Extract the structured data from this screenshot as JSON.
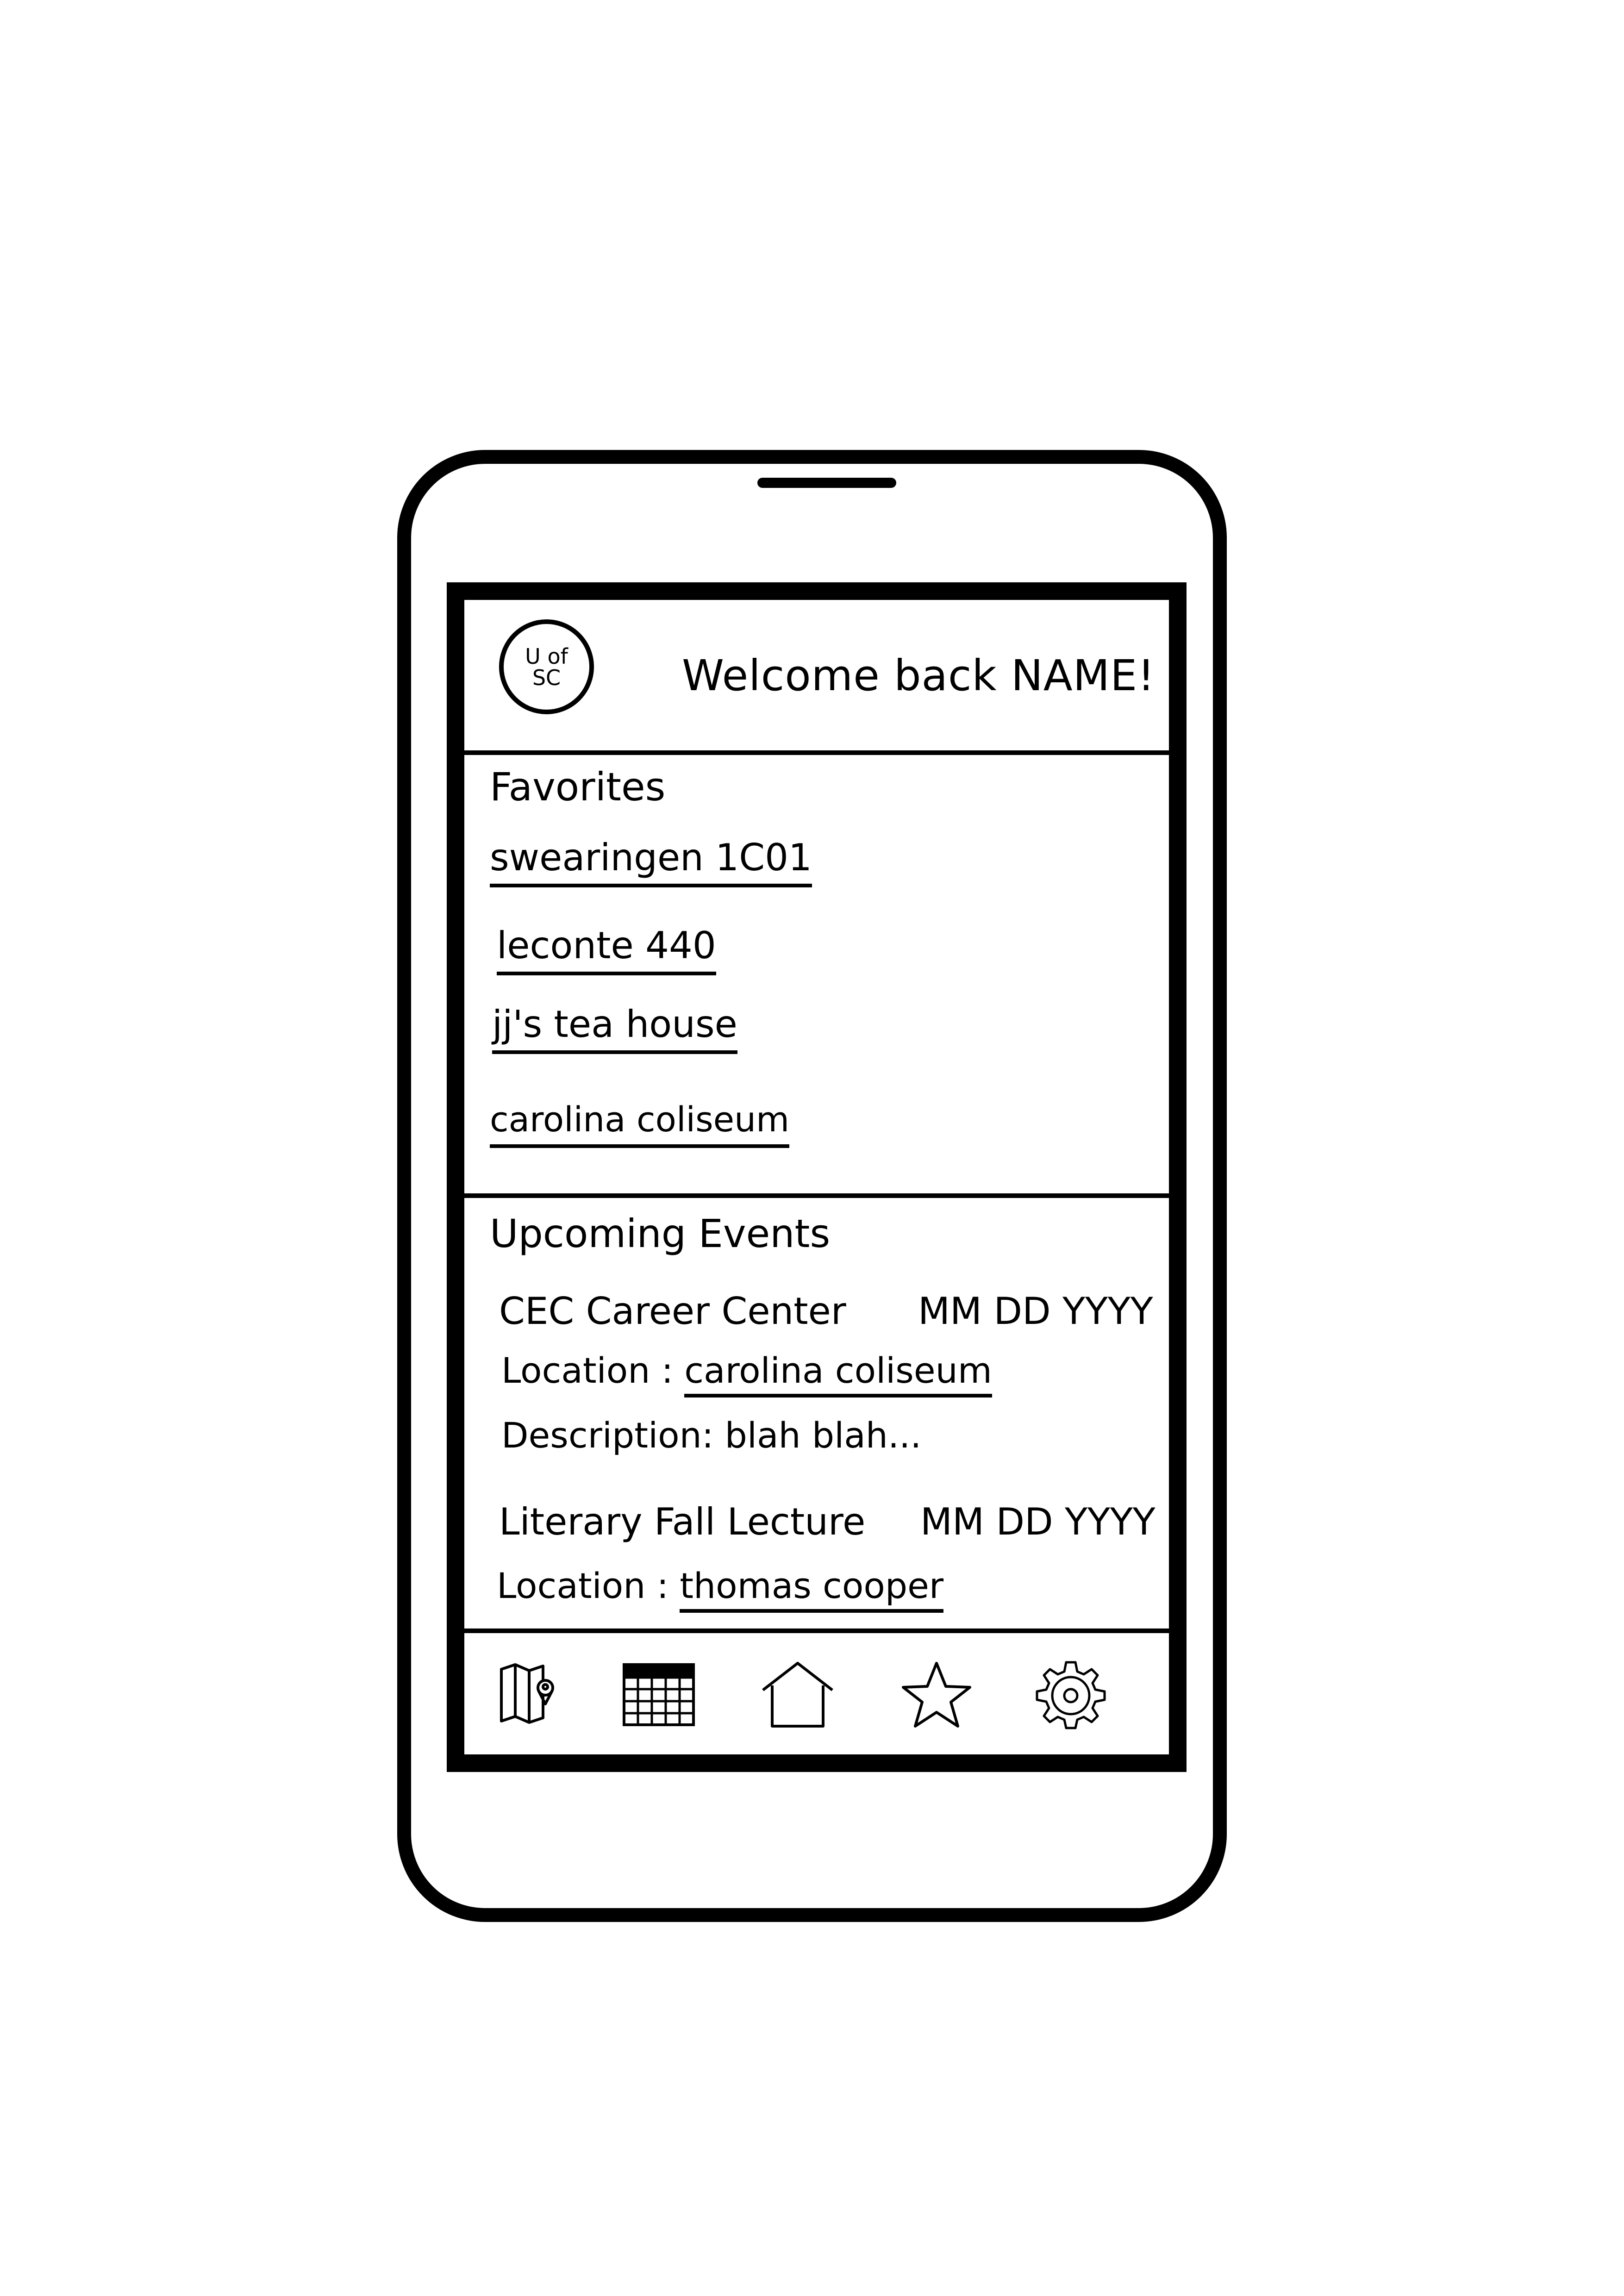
{
  "header": {
    "logo_line1": "U of",
    "logo_line2": "SC",
    "welcome": "Welcome back NAME!"
  },
  "favorites": {
    "title": "Favorites",
    "items": [
      "swearingen 1C01",
      "leconte 440",
      "jj's tea house",
      "carolina coliseum"
    ]
  },
  "events": {
    "title": "Upcoming Events",
    "items": [
      {
        "name": "CEC Career Center",
        "date": "MM DD YYYY",
        "location_label": "Location :",
        "location": "carolina coliseum",
        "description_label": "Description:",
        "description": "blah blah..."
      },
      {
        "name": "Literary Fall Lecture",
        "date": "MM DD YYYY",
        "location_label": "Location :",
        "location": "thomas cooper"
      }
    ]
  },
  "nav": {
    "icons": [
      "map-icon",
      "calendar-icon",
      "home-icon",
      "star-icon",
      "gear-icon"
    ]
  }
}
